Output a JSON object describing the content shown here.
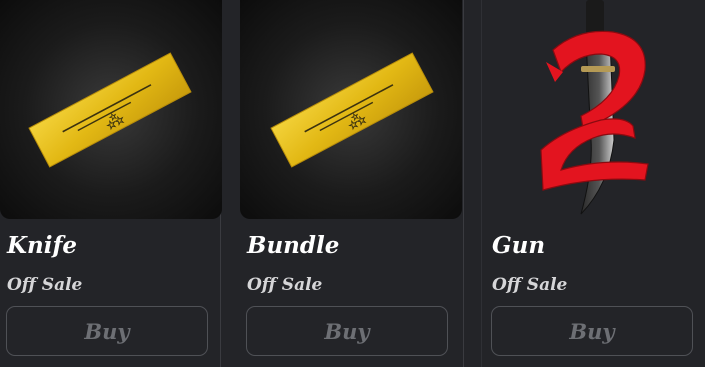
{
  "items": [
    {
      "name": "Knife",
      "status": "Off Sale",
      "button": "Buy",
      "icon": "gold-bar-thumbnail"
    },
    {
      "name": "Bundle",
      "status": "Off Sale",
      "button": "Buy",
      "icon": "gold-bar-thumbnail"
    },
    {
      "name": "Gun",
      "status": "Off Sale",
      "button": "Buy",
      "icon": "red-blade-thumbnail"
    }
  ],
  "colors": {
    "background": "#232428",
    "name_text": "#ffffff",
    "status_text": "#d6d6d8",
    "button_text_disabled": "#6d6f74",
    "button_border": "#4f5156",
    "gold": "#e8c21a",
    "red": "#e3141f"
  }
}
